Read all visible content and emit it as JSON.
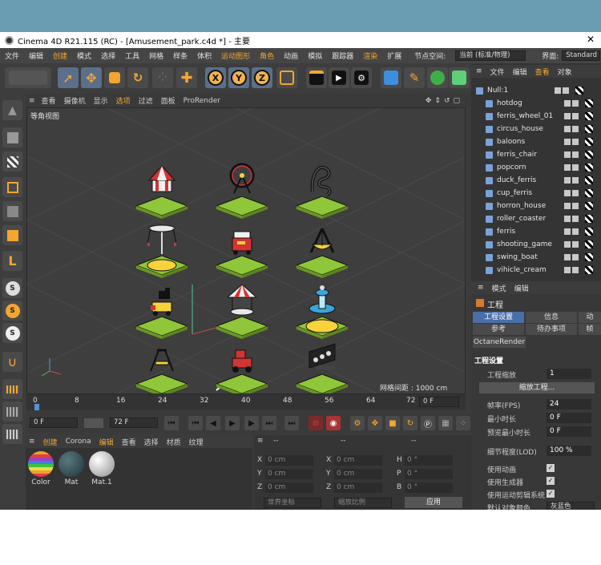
{
  "window": {
    "title": "Cinema 4D R21.115 (RC) - [Amusement_park.c4d *] - 主要",
    "close_glyph": "✕"
  },
  "menubar": {
    "items": [
      "文件",
      "编辑",
      "创建",
      "模式",
      "选择",
      "工具",
      "网格",
      "样条",
      "体积",
      "运动图形",
      "角色",
      "动画",
      "模拟",
      "跟踪器",
      "渲染",
      "扩展"
    ],
    "node_space_label": "节点空间:",
    "node_space_value": "当前 (标准/物理)",
    "layout_label": "界面:",
    "layout_value": "Standard"
  },
  "toolbar": {
    "axis_x": "X",
    "axis_y": "Y",
    "axis_z": "Z"
  },
  "viewport": {
    "menu": [
      "查看",
      "摄像机",
      "显示",
      "选项",
      "过滤",
      "面板",
      "ProRender"
    ],
    "label": "等角视图",
    "grid_info": "网格间距 : 1000 cm"
  },
  "timeline": {
    "ticks": [
      "0",
      "8",
      "16",
      "24",
      "32",
      "40",
      "48",
      "56",
      "64",
      "72"
    ],
    "end_field": "0 F"
  },
  "playback": {
    "current_frame": "0 F",
    "end_frame": "72 F"
  },
  "materials": {
    "menu": [
      "创建",
      "Corona",
      "编辑",
      "查看",
      "选择",
      "材质",
      "纹理"
    ],
    "items": [
      {
        "name": "Color",
        "color": "rainbow"
      },
      {
        "name": "Mat",
        "color": "#2f4b50"
      },
      {
        "name": "Mat.1",
        "color": "#d8d8d8"
      }
    ]
  },
  "coordinates": {
    "header": [
      "--",
      "--",
      "--"
    ],
    "labels_left": [
      "X",
      "Y",
      "Z"
    ],
    "labels_mid": [
      "X",
      "Y",
      "Z"
    ],
    "labels_right": [
      "H",
      "P",
      "B"
    ],
    "values_left": [
      "0 cm",
      "0 cm",
      "0 cm"
    ],
    "values_mid": [
      "0 cm",
      "0 cm",
      "0 cm"
    ],
    "values_right": [
      "0 °",
      "0 °",
      "0 °"
    ],
    "world_coords": "世界坐标",
    "scale_mode": "缩放比例",
    "apply": "应用"
  },
  "objects": {
    "menu": [
      "文件",
      "编辑",
      "查看",
      "对象"
    ],
    "root": "Null:1",
    "items": [
      "hotdog",
      "ferris_wheel_01",
      "circus_house",
      "baloons",
      "ferris_chair",
      "popcorn",
      "duck_ferris",
      "cup_ferris",
      "horron_house",
      "roller_coaster",
      "ferris",
      "shooting_game",
      "swing_boat",
      "vihicle_cream"
    ]
  },
  "attributes": {
    "menu": [
      "模式",
      "编辑"
    ],
    "section": "工程",
    "tabs_row1": [
      "工程设置",
      "信息",
      "动"
    ],
    "tabs_row2": [
      "参考",
      "待办事项",
      "帧"
    ],
    "tab_octane": "OctaneRender",
    "heading": "工程设置",
    "project_scale_label": "工程缩放",
    "project_scale_value": "1",
    "scale_button": "缩放工程...",
    "fps_label": "帧率(FPS)",
    "fps_value": "24",
    "min_time_label": "最小时长",
    "min_time_value": "0 F",
    "preview_min_label": "预览最小时长",
    "preview_min_value": "0 F",
    "lod_label": "细节程度(LOD)",
    "lod_value": "100 %",
    "use_animation": "使用动画",
    "use_generators": "使用生成器",
    "use_motion_system": "使用运动剪辑系统",
    "default_object_color": "默认对象颜色",
    "default_object_color_value": "灰蓝色"
  },
  "colors": {
    "accent": "#f5a531",
    "tile_green": "#8fc63a",
    "tile_yellow": "#f6d23b"
  }
}
